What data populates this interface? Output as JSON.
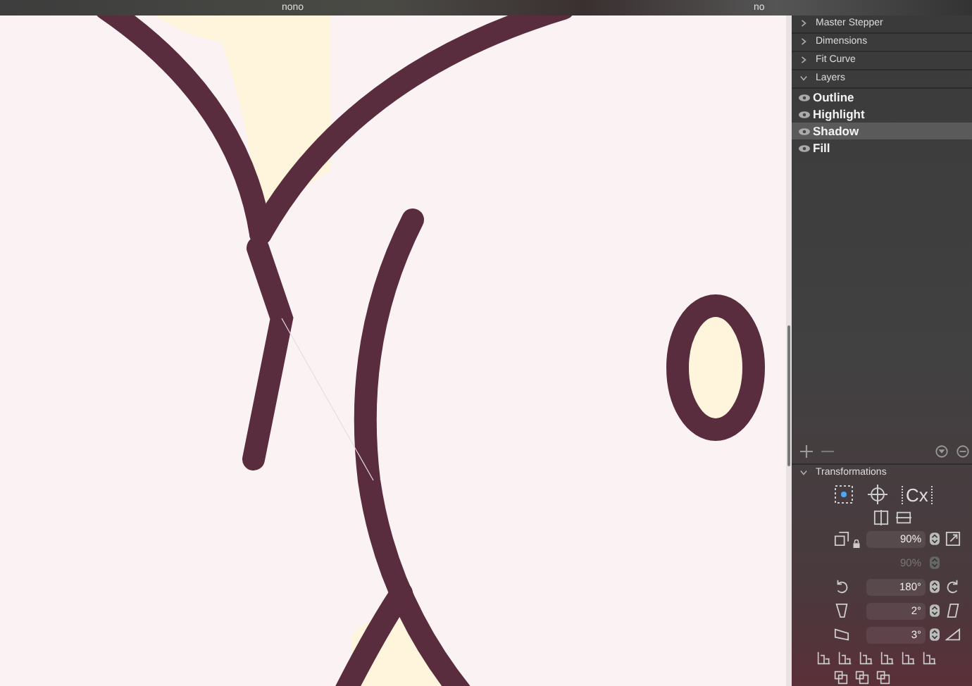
{
  "tabs": [
    {
      "label": "nono"
    },
    {
      "label": "no"
    }
  ],
  "panel": {
    "sections": [
      {
        "label": "Master Stepper",
        "expanded": false
      },
      {
        "label": "Dimensions",
        "expanded": false
      },
      {
        "label": "Fit Curve",
        "expanded": false
      },
      {
        "label": "Layers",
        "expanded": true
      }
    ],
    "layers": [
      {
        "name": "Outline",
        "selected": false
      },
      {
        "name": "Highlight",
        "selected": false
      },
      {
        "name": "Shadow",
        "selected": true
      },
      {
        "name": "Fill",
        "selected": false
      }
    ],
    "transformations": {
      "title": "Transformations",
      "expanded": true,
      "origin_label": "Cx",
      "fields": [
        {
          "kind": "scale",
          "value": "90%",
          "disabled": false
        },
        {
          "kind": "scale-y",
          "value": "90%",
          "disabled": true
        },
        {
          "kind": "rotate",
          "value": "180°",
          "disabled": false
        },
        {
          "kind": "slant",
          "value": "2°",
          "disabled": false
        },
        {
          "kind": "skew",
          "value": "3°",
          "disabled": false
        }
      ]
    }
  }
}
